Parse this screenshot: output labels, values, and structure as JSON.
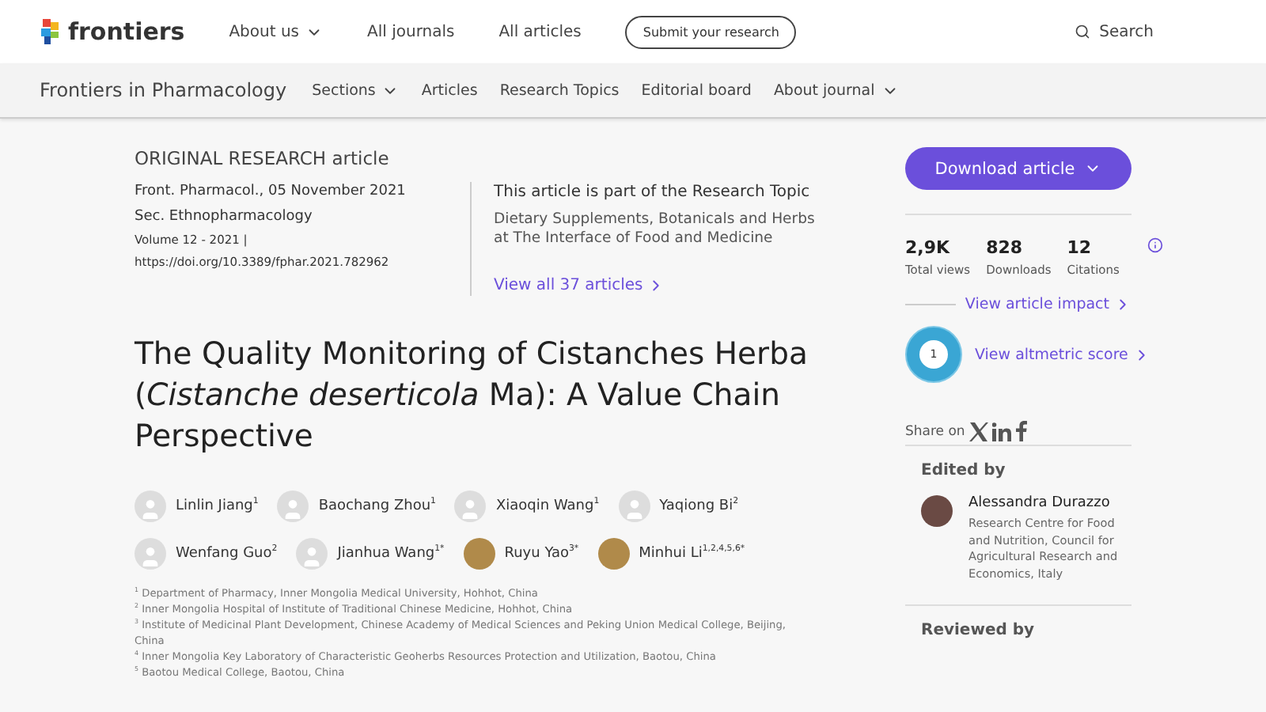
{
  "header": {
    "logo": "frontiers",
    "nav": [
      {
        "label": "About us",
        "dropdown": true
      },
      {
        "label": "All journals",
        "dropdown": false
      },
      {
        "label": "All articles",
        "dropdown": false
      }
    ],
    "submit": "Submit your research",
    "search": "Search"
  },
  "subnav": {
    "journal": "Frontiers in Pharmacology",
    "items": [
      {
        "label": "Sections",
        "dropdown": true
      },
      {
        "label": "Articles",
        "dropdown": false
      },
      {
        "label": "Research Topics",
        "dropdown": false
      },
      {
        "label": "Editorial board",
        "dropdown": false
      },
      {
        "label": "About journal",
        "dropdown": true
      }
    ]
  },
  "article": {
    "type": "ORIGINAL RESEARCH article",
    "citation": "Front. Pharmacol., 05 November 2021",
    "section": "Sec. Ethnopharmacology",
    "volume": "Volume 12 - 2021 |",
    "doi": "https://doi.org/10.3389/fphar.2021.782962",
    "topic": {
      "intro": "This article is part of the Research Topic",
      "name": "Dietary Supplements, Botanicals and Herbs at The Interface of Food and Medicine",
      "link": "View all 37 articles"
    },
    "title": "The Quality Monitoring of Cistanches Herba (*Cistanche deserticola* Ma): A Value Chain Perspective",
    "authors": [
      {
        "name": "Linlin Jiang$^{1}$",
        "has_photo": false
      },
      {
        "name": "Baochang Zhou$^{1}$",
        "has_photo": false
      },
      {
        "name": "Xiaoqin Wang$^{1}$",
        "has_photo": false
      },
      {
        "name": "Yaqiong Bi$^{2}$",
        "has_photo": false
      },
      {
        "name": "Wenfang Guo$^{2}$",
        "has_photo": false
      },
      {
        "name": "Jianhua Wang$^{1*}$",
        "has_photo": false
      },
      {
        "name": "Ruyu Yao$^{3*}$",
        "has_photo": true
      },
      {
        "name": "Minhui Li$^{1,2,4,5,6*}$",
        "has_photo": true
      }
    ],
    "affiliations": [
      "$^{1}$ Department of Pharmacy, Inner Mongolia Medical University, Hohhot, China",
      "$^{2}$ Inner Mongolia Hospital of Institute of Traditional Chinese Medicine, Hohhot, China",
      "$^{3}$ Institute of Medicinal Plant Development, Chinese Academy of Medical Sciences and Peking Union Medical College, Beijing, China",
      "$^{4}$ Inner Mongolia Key Laboratory of Characteristic Geoherbs Resources Protection and Utilization, Baotou, China",
      "$^{5}$ Baotou Medical College, Baotou, China"
    ]
  },
  "sidebar": {
    "download": "Download article",
    "stats": [
      {
        "value": "2,9K",
        "label": "Total views"
      },
      {
        "value": "828",
        "label": "Downloads"
      },
      {
        "value": "12",
        "label": "Citations"
      }
    ],
    "impact": "View article impact",
    "altmetric": {
      "score": "1",
      "link": "View altmetric score"
    },
    "share": "Share on",
    "edited_heading": "Edited by",
    "editor": {
      "name": "Alessandra Durazzo",
      "affiliation": "Research Centre for Food and Nutrition, Council for Agricultural Research and Economics, Italy"
    },
    "reviewed_heading": "Reviewed by"
  }
}
